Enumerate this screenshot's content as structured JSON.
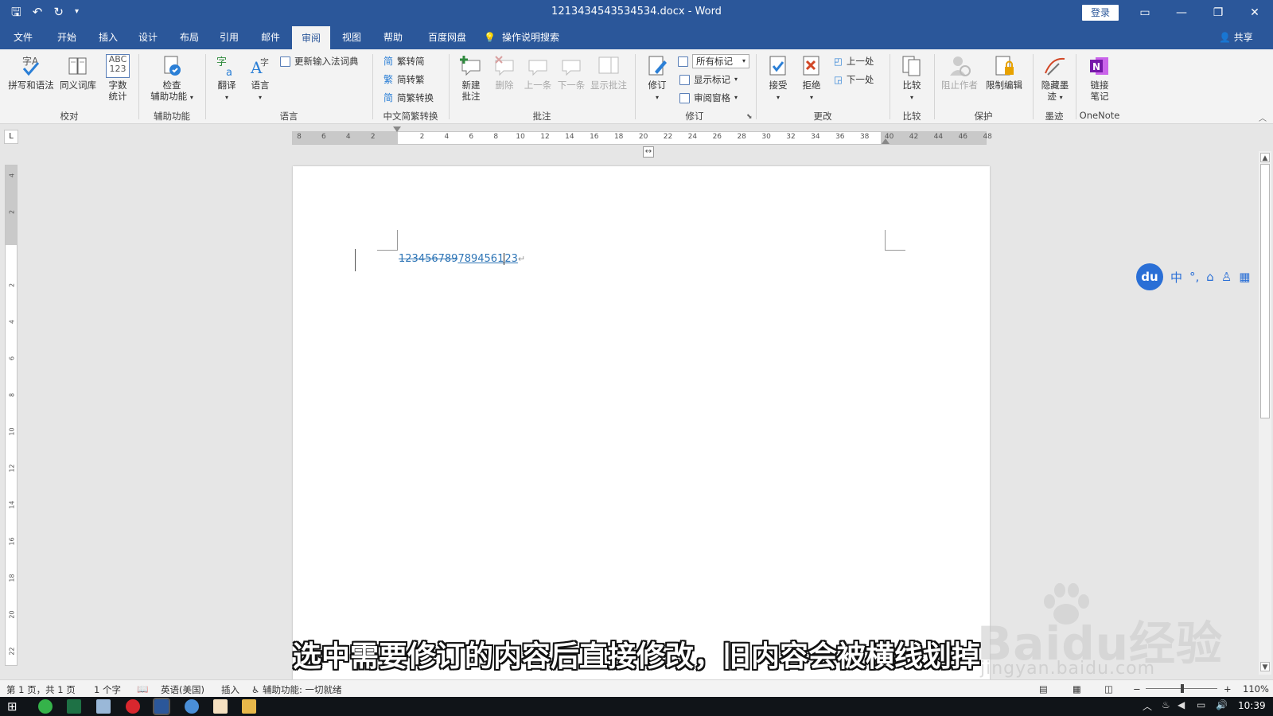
{
  "window": {
    "title": "1213434543534534.docx  -  Word",
    "login_label": "登录"
  },
  "tabs": [
    {
      "label": "文件"
    },
    {
      "label": "开始"
    },
    {
      "label": "插入"
    },
    {
      "label": "设计"
    },
    {
      "label": "布局"
    },
    {
      "label": "引用"
    },
    {
      "label": "邮件"
    },
    {
      "label": "审阅"
    },
    {
      "label": "视图"
    },
    {
      "label": "帮助"
    },
    {
      "label": "百度网盘"
    }
  ],
  "active_tab": "审阅",
  "tell_me": "操作说明搜索",
  "share_label": "共享",
  "ribbon": {
    "proofing": {
      "spell": "拼写和语法",
      "thesaurus": "同义词库",
      "wordcount_l1": "字数",
      "wordcount_l2": "统计",
      "wordcount_icon_text": "ABC 123",
      "group": "校对"
    },
    "accessibility": {
      "check_l1": "检查",
      "check_l2": "辅助功能",
      "group": "辅助功能"
    },
    "language": {
      "translate": "翻译",
      "language": "语言",
      "update_ime": "更新输入法词典",
      "group": "语言"
    },
    "chinese": {
      "trad2simp": "繁转简",
      "simp2trad": "简转繁",
      "convert": "简繁转换",
      "group": "中文简繁转换"
    },
    "comments": {
      "new_l1": "新建",
      "new_l2": "批注",
      "delete": "删除",
      "prev": "上一条",
      "next": "下一条",
      "show": "显示批注",
      "group": "批注"
    },
    "tracking": {
      "track": "修订",
      "markup_select": "所有标记",
      "show_markup": "显示标记",
      "reviewing_pane": "审阅窗格",
      "group": "修订"
    },
    "changes": {
      "accept": "接受",
      "reject": "拒绝",
      "prev": "上一处",
      "next": "下一处",
      "group": "更改"
    },
    "compare": {
      "compare": "比较",
      "group": "比较"
    },
    "protect": {
      "block_authors": "阻止作者",
      "restrict": "限制编辑",
      "group": "保护"
    },
    "ink": {
      "hide_l1": "隐藏墨",
      "hide_l2": "迹",
      "group": "墨迹"
    },
    "onenote": {
      "link_l1": "链接",
      "link_l2": "笔记",
      "group": "OneNote"
    }
  },
  "ruler": {
    "horizontal_ticks": [
      "8",
      "6",
      "4",
      "2",
      "",
      "2",
      "4",
      "6",
      "8",
      "10",
      "12",
      "14",
      "16",
      "18",
      "20",
      "22",
      "24",
      "26",
      "28",
      "30",
      "32",
      "34",
      "36",
      "38",
      "40",
      "42",
      "44",
      "46",
      "48"
    ],
    "vertical_ticks": [
      "4",
      "2",
      "",
      "2",
      "4",
      "6",
      "8",
      "10",
      "12",
      "14",
      "16",
      "18",
      "20",
      "22"
    ],
    "corner_label": "L"
  },
  "document": {
    "deleted_text": "123456789",
    "inserted_text": "7894561",
    "inserted_text_tail": "23",
    "paragraph_mark": "↵"
  },
  "ime": {
    "logo": "du",
    "items": [
      "中",
      "°,",
      "⌂",
      "♙",
      "▦"
    ]
  },
  "subtitle": "选中需要修订的内容后直接修改，旧内容会被横线划掉",
  "watermark": {
    "brand": "Baidu经验",
    "url": "jingyan.baidu.com"
  },
  "statusbar": {
    "page": "第 1 页，共 1 页",
    "words": "1 个字",
    "language": "英语(美国)",
    "mode": "插入",
    "accessibility": "辅助功能: 一切就绪",
    "zoom": "110%"
  },
  "taskbar": {
    "clock": "10:39"
  },
  "colors": {
    "accent": "#2b579a",
    "revision": "#2e75b6"
  }
}
